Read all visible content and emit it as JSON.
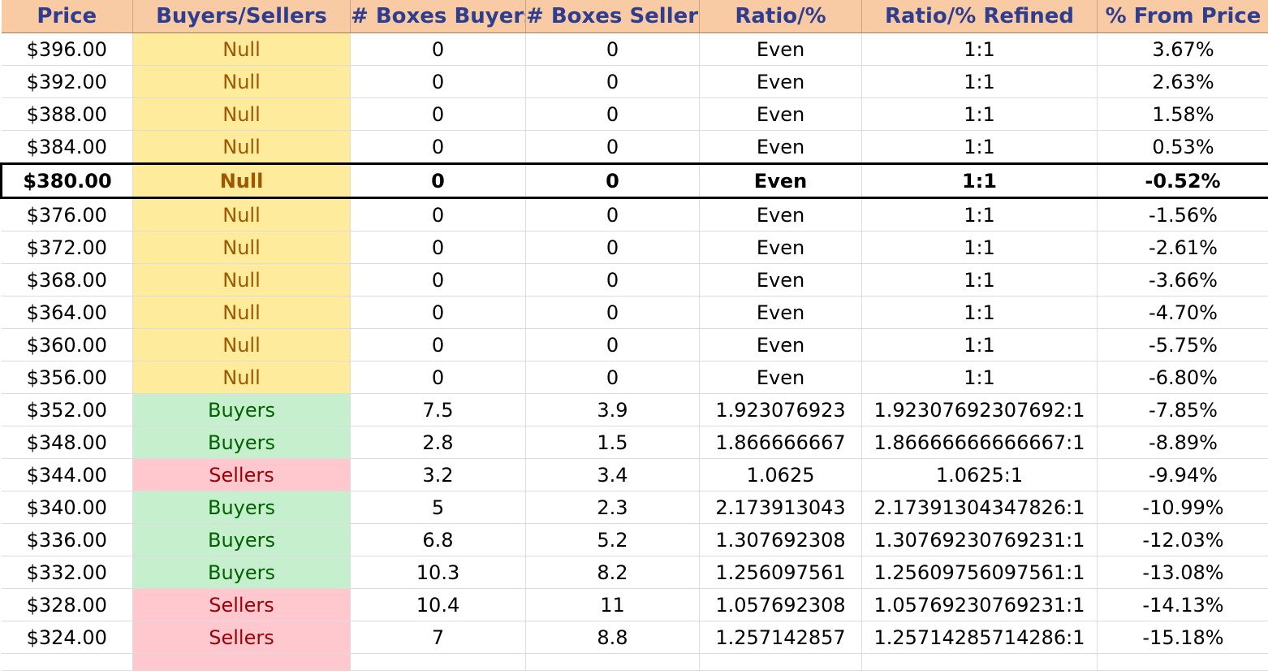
{
  "headers": [
    "Price",
    "Buyers/Sellers",
    "# Boxes Buyers",
    "# Boxes Sellers",
    "Ratio/%",
    "Ratio/% Refined",
    "% From Price"
  ],
  "colors": {
    "header_bg": "#f8cba4",
    "header_text": "#2f3d8f",
    "null_bg": "#ffeb9c",
    "null_text": "#9c5700",
    "buyers_bg": "#c6efce",
    "buyers_text": "#006100",
    "sellers_bg": "#ffc7ce",
    "sellers_text": "#9c0006"
  },
  "rows": [
    {
      "price": "$396.00",
      "side": "Null",
      "kind": "null",
      "buyers": "0",
      "sellers": "0",
      "ratio": "Even",
      "refined": "1:1",
      "pct": "3.67%"
    },
    {
      "price": "$392.00",
      "side": "Null",
      "kind": "null",
      "buyers": "0",
      "sellers": "0",
      "ratio": "Even",
      "refined": "1:1",
      "pct": "2.63%"
    },
    {
      "price": "$388.00",
      "side": "Null",
      "kind": "null",
      "buyers": "0",
      "sellers": "0",
      "ratio": "Even",
      "refined": "1:1",
      "pct": "1.58%"
    },
    {
      "price": "$384.00",
      "side": "Null",
      "kind": "null",
      "buyers": "0",
      "sellers": "0",
      "ratio": "Even",
      "refined": "1:1",
      "pct": "0.53%"
    },
    {
      "price": "$380.00",
      "side": "Null",
      "kind": "null",
      "buyers": "0",
      "sellers": "0",
      "ratio": "Even",
      "refined": "1:1",
      "pct": "-0.52%",
      "current": true
    },
    {
      "price": "$376.00",
      "side": "Null",
      "kind": "null",
      "buyers": "0",
      "sellers": "0",
      "ratio": "Even",
      "refined": "1:1",
      "pct": "-1.56%"
    },
    {
      "price": "$372.00",
      "side": "Null",
      "kind": "null",
      "buyers": "0",
      "sellers": "0",
      "ratio": "Even",
      "refined": "1:1",
      "pct": "-2.61%"
    },
    {
      "price": "$368.00",
      "side": "Null",
      "kind": "null",
      "buyers": "0",
      "sellers": "0",
      "ratio": "Even",
      "refined": "1:1",
      "pct": "-3.66%"
    },
    {
      "price": "$364.00",
      "side": "Null",
      "kind": "null",
      "buyers": "0",
      "sellers": "0",
      "ratio": "Even",
      "refined": "1:1",
      "pct": "-4.70%"
    },
    {
      "price": "$360.00",
      "side": "Null",
      "kind": "null",
      "buyers": "0",
      "sellers": "0",
      "ratio": "Even",
      "refined": "1:1",
      "pct": "-5.75%"
    },
    {
      "price": "$356.00",
      "side": "Null",
      "kind": "null",
      "buyers": "0",
      "sellers": "0",
      "ratio": "Even",
      "refined": "1:1",
      "pct": "-6.80%"
    },
    {
      "price": "$352.00",
      "side": "Buyers",
      "kind": "buyers",
      "buyers": "7.5",
      "sellers": "3.9",
      "ratio": "1.923076923",
      "refined": "1.92307692307692:1",
      "pct": "-7.85%"
    },
    {
      "price": "$348.00",
      "side": "Buyers",
      "kind": "buyers",
      "buyers": "2.8",
      "sellers": "1.5",
      "ratio": "1.866666667",
      "refined": "1.86666666666667:1",
      "pct": "-8.89%"
    },
    {
      "price": "$344.00",
      "side": "Sellers",
      "kind": "sellers",
      "buyers": "3.2",
      "sellers": "3.4",
      "ratio": "1.0625",
      "refined": "1.0625:1",
      "pct": "-9.94%"
    },
    {
      "price": "$340.00",
      "side": "Buyers",
      "kind": "buyers",
      "buyers": "5",
      "sellers": "2.3",
      "ratio": "2.173913043",
      "refined": "2.17391304347826:1",
      "pct": "-10.99%"
    },
    {
      "price": "$336.00",
      "side": "Buyers",
      "kind": "buyers",
      "buyers": "6.8",
      "sellers": "5.2",
      "ratio": "1.307692308",
      "refined": "1.30769230769231:1",
      "pct": "-12.03%"
    },
    {
      "price": "$332.00",
      "side": "Buyers",
      "kind": "buyers",
      "buyers": "10.3",
      "sellers": "8.2",
      "ratio": "1.256097561",
      "refined": "1.25609756097561:1",
      "pct": "-13.08%"
    },
    {
      "price": "$328.00",
      "side": "Sellers",
      "kind": "sellers",
      "buyers": "10.4",
      "sellers": "11",
      "ratio": "1.057692308",
      "refined": "1.05769230769231:1",
      "pct": "-14.13%"
    },
    {
      "price": "$324.00",
      "side": "Sellers",
      "kind": "sellers",
      "buyers": "7",
      "sellers": "8.8",
      "ratio": "1.257142857",
      "refined": "1.25714285714286:1",
      "pct": "-15.18%"
    }
  ]
}
